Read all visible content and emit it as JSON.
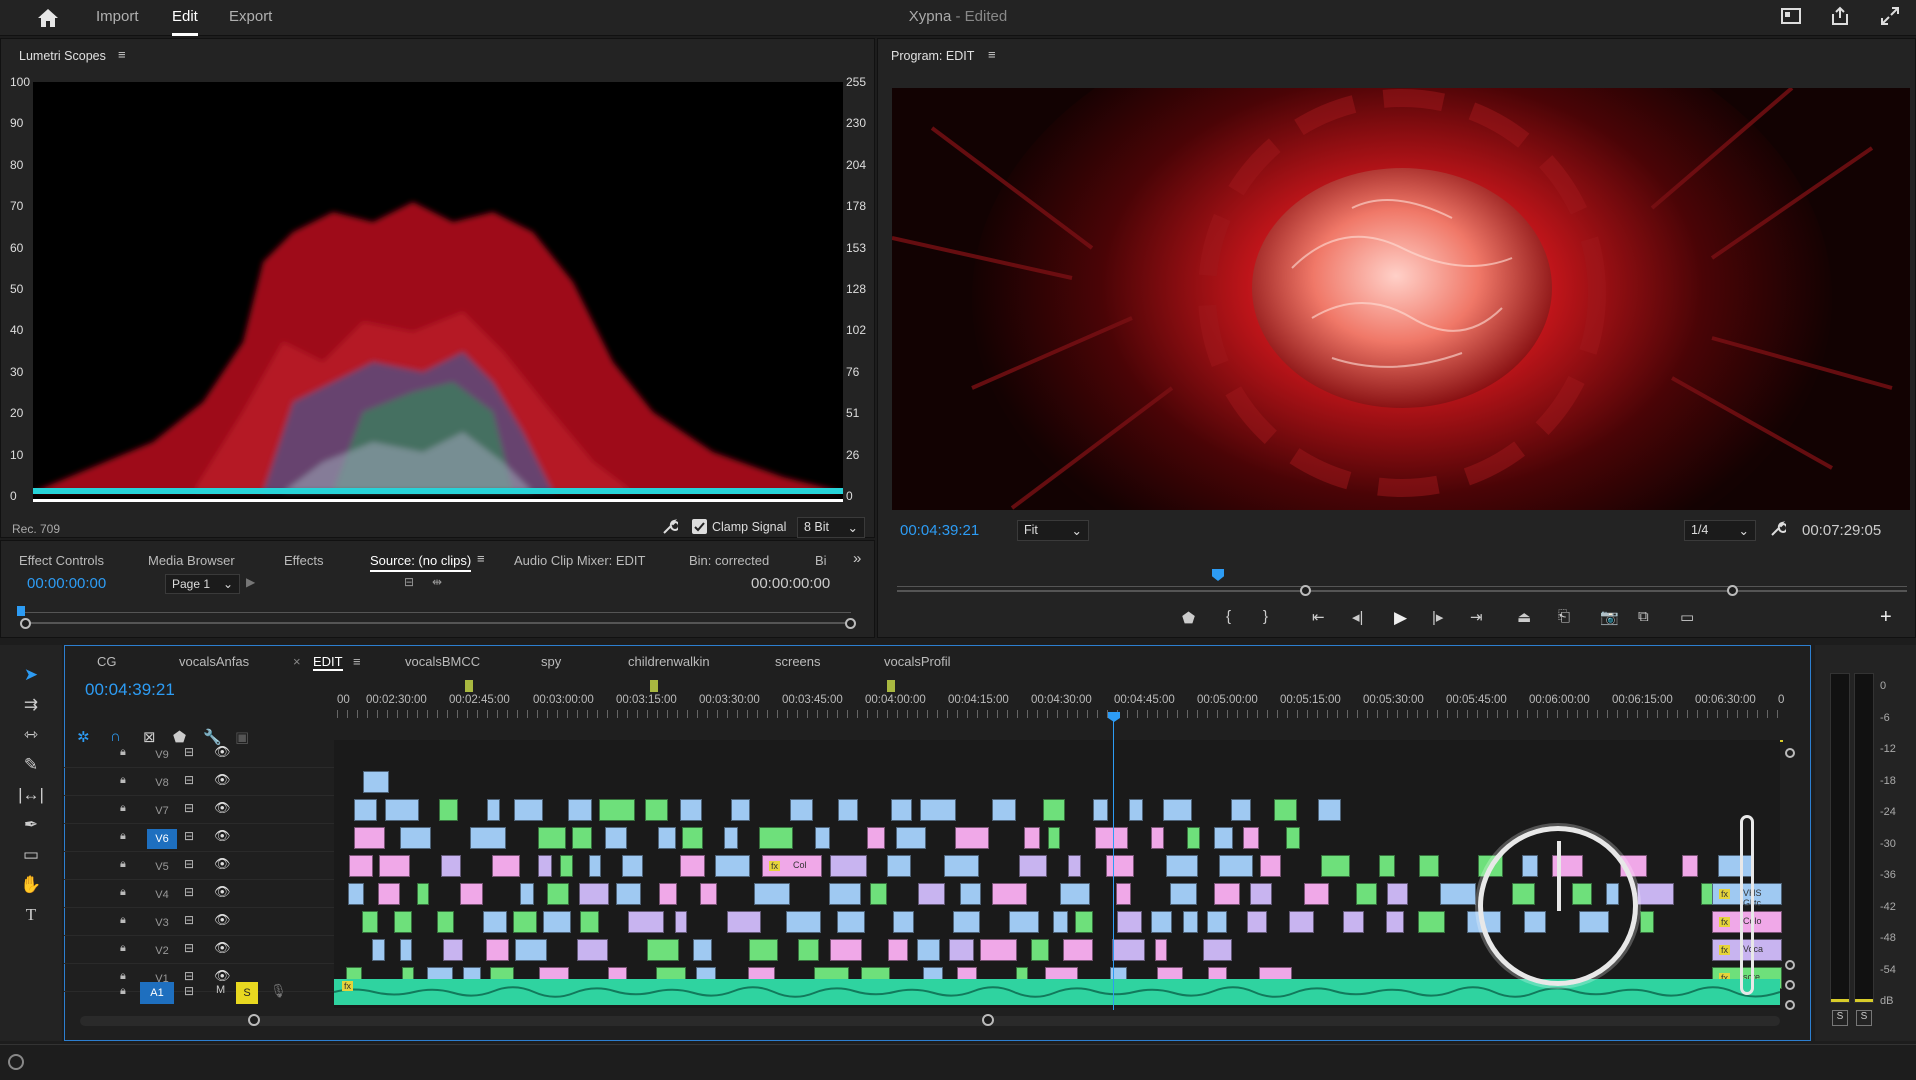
{
  "topbar": {
    "nav": [
      "Import",
      "Edit",
      "Export"
    ],
    "title": "Xypna",
    "subtitle": "- Edited"
  },
  "scopes": {
    "title": "Lumetri Scopes",
    "left_scale": [
      "100",
      "90",
      "80",
      "70",
      "60",
      "50",
      "40",
      "30",
      "20",
      "10",
      "0"
    ],
    "right_scale": [
      "255",
      "230",
      "204",
      "178",
      "153",
      "128",
      "102",
      "76",
      "51",
      "26",
      "0"
    ],
    "colorspace": "Rec. 709",
    "clamp_label": "Clamp Signal",
    "bit_depth": "8 Bit"
  },
  "program": {
    "title": "Program: EDIT",
    "timecode": "00:04:39:21",
    "fit": "Fit",
    "resolution": "1/4",
    "duration": "00:07:29:05"
  },
  "source_panel": {
    "tabs": [
      "Effect Controls",
      "Media Browser",
      "Effects",
      "Source: (no clips)",
      "Audio Clip Mixer: EDIT",
      "Bin: corrected",
      "Bi"
    ],
    "timecode_left": "00:00:00:00",
    "page": "Page 1",
    "timecode_right": "00:00:00:00"
  },
  "timeline": {
    "tabs": [
      "CG",
      "vocalsAnfas",
      "EDIT",
      "vocalsBMCC",
      "spy",
      "childrenwalkin",
      "screens",
      "vocalsProfil"
    ],
    "timecode": "00:04:39:21",
    "ruler": [
      "00",
      "00:02:30:00",
      "00:02:45:00",
      "00:03:00:00",
      "00:03:15:00",
      "00:03:30:00",
      "00:03:45:00",
      "00:04:00:00",
      "00:04:15:00",
      "00:04:30:00",
      "00:04:45:00",
      "00:05:00:00",
      "00:05:15:00",
      "00:05:30:00",
      "00:05:45:00",
      "00:06:00:00",
      "00:06:15:00",
      "00:06:30:00",
      "0"
    ],
    "tracks": [
      "V9",
      "V8",
      "V7",
      "V6",
      "V5",
      "V4",
      "V3",
      "V2",
      "V1"
    ],
    "audio_track": "A1",
    "audio_m": "M",
    "audio_s": "S",
    "clip_labels": {
      "col": "Col",
      "vhs": "VHS Glitc",
      "colo": "Colo",
      "voca": "Voca",
      "scre": "scre"
    },
    "fx": "fx"
  },
  "meter": {
    "scale": [
      "0",
      "-6",
      "-12",
      "-18",
      "-24",
      "-30",
      "-36",
      "-42",
      "-48",
      "-54",
      "dB"
    ],
    "solo_left": "S",
    "solo_right": "S"
  },
  "colors": {
    "accent": "#2d9cf4",
    "clip_blue": "#9fc9f2",
    "clip_green": "#6ee07b",
    "clip_pink": "#f0a8e8",
    "audio": "#2fd3a0"
  }
}
